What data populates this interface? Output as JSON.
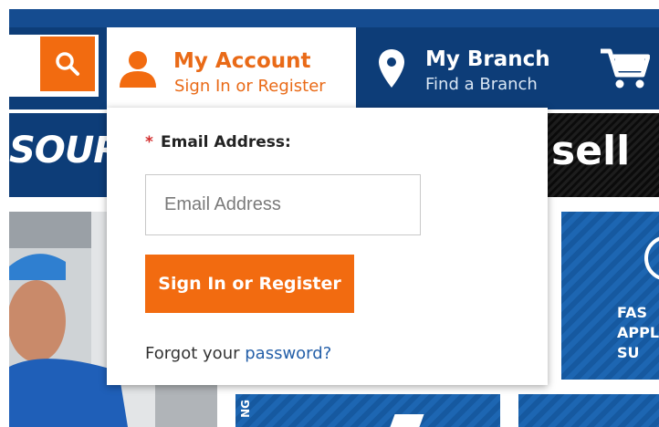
{
  "header": {
    "account": {
      "title": "My Account",
      "subtitle": "Sign In or Register"
    },
    "branch": {
      "title": "My Branch",
      "subtitle": "Find a Branch"
    },
    "icons": {
      "search": "search-icon",
      "account": "user-icon",
      "branch": "map-pin-icon",
      "cart": "shopping-cart-icon"
    }
  },
  "background": {
    "banner_left_text": "SOURC",
    "banner_right_text": "sell",
    "tile_text": "FAS\nAPPL\nSU",
    "vertical_label": "NG"
  },
  "login": {
    "required_mark": "*",
    "email_label": "Email Address:",
    "email_placeholder": "Email Address",
    "email_value": "",
    "submit_label": "Sign In or Register",
    "forgot_prefix": "Forgot your ",
    "forgot_link": "password?"
  },
  "colors": {
    "accent": "#f26b10",
    "header_bg": "#0d3d78",
    "link": "#245fa8",
    "required": "#d32f2f"
  }
}
